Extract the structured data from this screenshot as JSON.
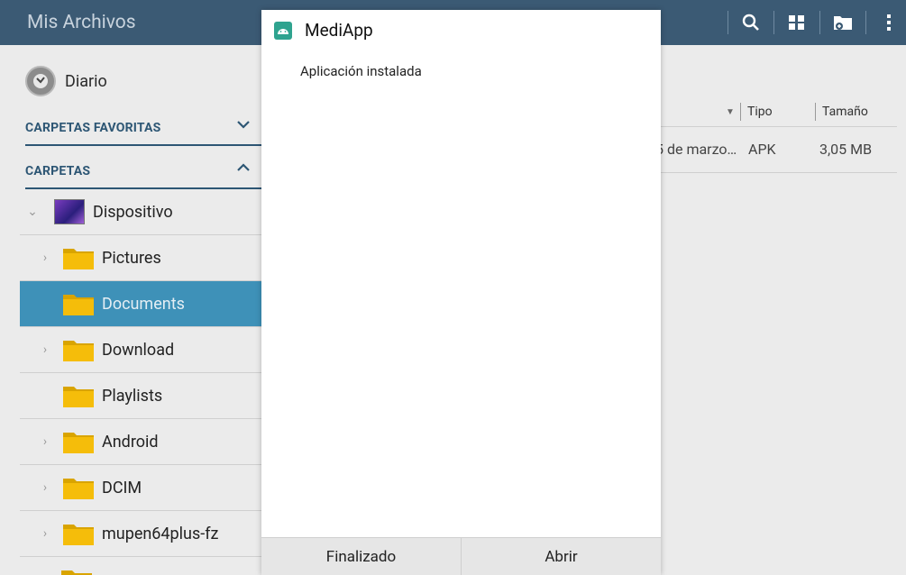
{
  "app": {
    "title": "Mis Archivos"
  },
  "toolbar": {
    "icons": [
      "search-icon",
      "grid-view-icon",
      "new-folder-icon",
      "more-vert-icon"
    ]
  },
  "sidebar": {
    "diario": "Diario",
    "favorites_header": "CARPETAS FAVORITAS",
    "folders_header": "CARPETAS",
    "tree": [
      {
        "label": "Dispositivo",
        "expanded": true
      },
      {
        "label": "Pictures"
      },
      {
        "label": "Documents",
        "selected": true
      },
      {
        "label": "Download"
      },
      {
        "label": "Playlists"
      },
      {
        "label": "Android"
      },
      {
        "label": "DCIM"
      },
      {
        "label": "mupen64plus-fz"
      }
    ]
  },
  "file_list": {
    "columns": {
      "type": "Tipo",
      "size": "Tamaño"
    },
    "rows": [
      {
        "date": "5 de marzo…",
        "type": "APK",
        "size": "3,05 MB"
      }
    ]
  },
  "dialog": {
    "title": "MediApp",
    "message": "Aplicación instalada",
    "button_done": "Finalizado",
    "button_open": "Abrir"
  },
  "colors": {
    "topbar": "#3b5a74",
    "accent": "#2d5674",
    "selected_row": "#3e91b8",
    "app_icon": "#2fa38f",
    "folder": "#f2b705"
  }
}
